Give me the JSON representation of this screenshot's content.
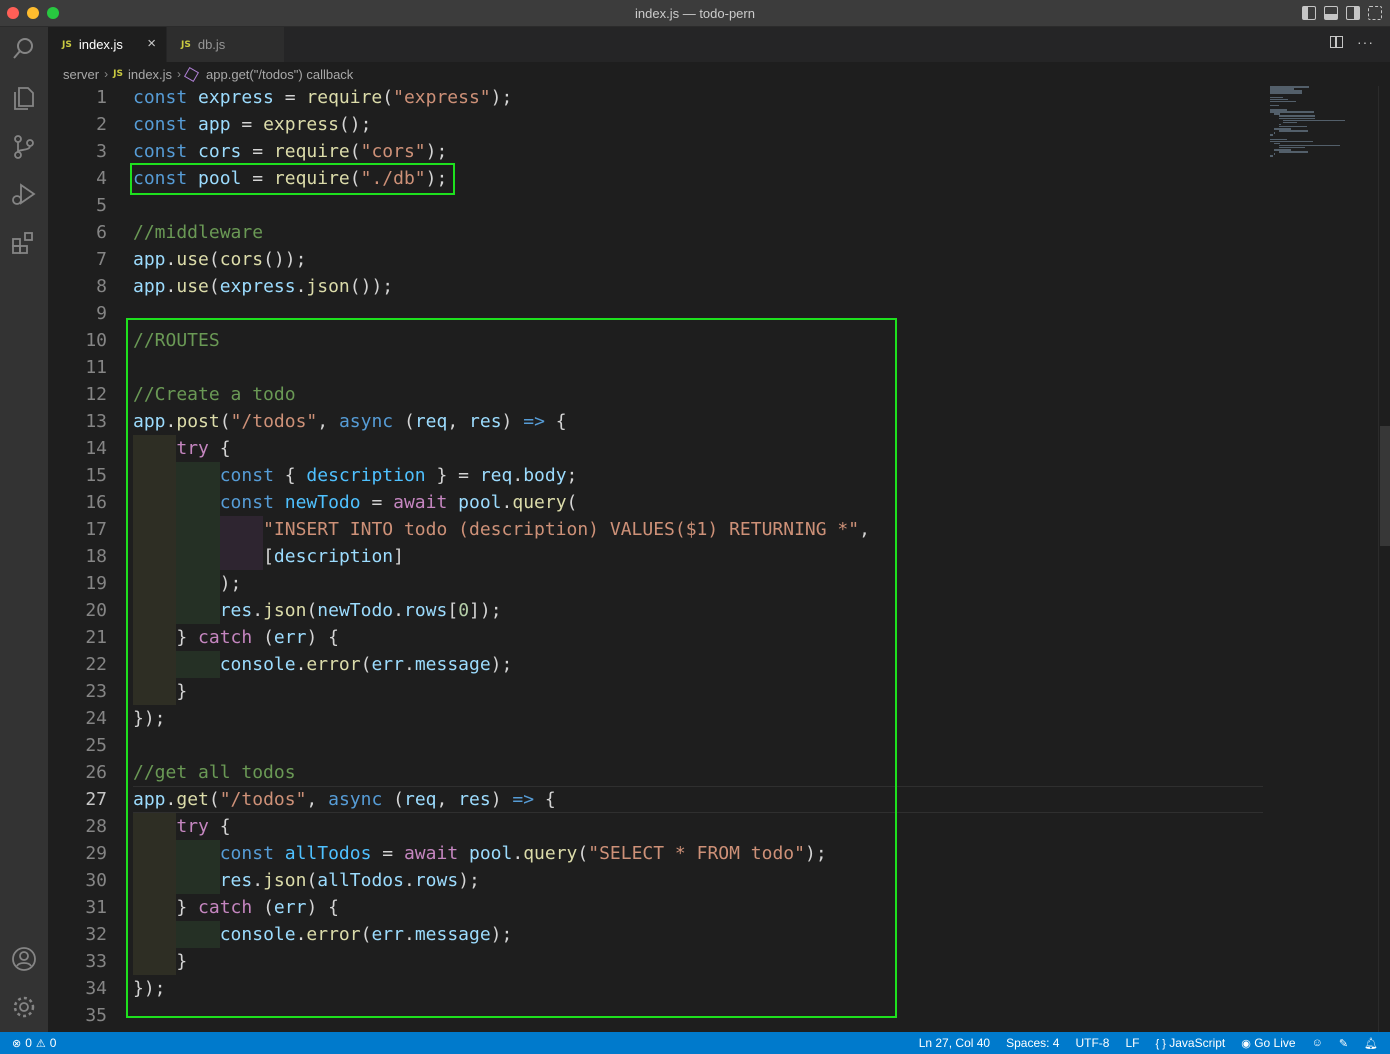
{
  "window": {
    "title": "index.js — todo-pern"
  },
  "tabs": [
    {
      "label": "index.js",
      "badge": "JS",
      "active": true
    },
    {
      "label": "db.js",
      "badge": "JS",
      "active": false
    }
  ],
  "breadcrumb": {
    "folder": "server",
    "file_badge": "JS",
    "file": "index.js",
    "symbol": "app.get(\"/todos\") callback"
  },
  "editor": {
    "active_line": 27,
    "lines": [
      {
        "n": "1"
      },
      {
        "n": "2"
      },
      {
        "n": "3"
      },
      {
        "n": "4"
      },
      {
        "n": "5"
      },
      {
        "n": "6"
      },
      {
        "n": "7"
      },
      {
        "n": "8"
      },
      {
        "n": "9"
      },
      {
        "n": "10"
      },
      {
        "n": "11"
      },
      {
        "n": "12"
      },
      {
        "n": "13"
      },
      {
        "n": "14"
      },
      {
        "n": "15"
      },
      {
        "n": "16"
      },
      {
        "n": "17"
      },
      {
        "n": "18"
      },
      {
        "n": "19"
      },
      {
        "n": "20"
      },
      {
        "n": "21"
      },
      {
        "n": "22"
      },
      {
        "n": "23"
      },
      {
        "n": "24"
      },
      {
        "n": "25"
      },
      {
        "n": "26"
      },
      {
        "n": "27"
      },
      {
        "n": "28"
      },
      {
        "n": "29"
      },
      {
        "n": "30"
      },
      {
        "n": "31"
      },
      {
        "n": "32"
      },
      {
        "n": "33"
      },
      {
        "n": "34"
      },
      {
        "n": "35"
      }
    ],
    "code": {
      "l1": [
        "const",
        " ",
        "express",
        " = ",
        "require",
        "(",
        "\"express\"",
        ");"
      ],
      "l2": [
        "const",
        " ",
        "app",
        " = ",
        "express",
        "();"
      ],
      "l3": [
        "const",
        " ",
        "cors",
        " = ",
        "require",
        "(",
        "\"cors\"",
        ");"
      ],
      "l4": [
        "const",
        " ",
        "pool",
        " = ",
        "require",
        "(",
        "\"./db\"",
        ");"
      ],
      "l6": "//middleware",
      "l7": [
        "app",
        ".",
        "use",
        "(",
        "cors",
        "());"
      ],
      "l8": [
        "app",
        ".",
        "use",
        "(",
        "express",
        ".",
        "json",
        "());"
      ],
      "l10": "//ROUTES",
      "l12": "//Create a todo",
      "l13": [
        "app",
        ".",
        "post",
        "(",
        "\"/todos\"",
        ", ",
        "async",
        " (",
        "req",
        ", ",
        "res",
        ") ",
        "=>",
        " {"
      ],
      "l14": [
        "try",
        " {"
      ],
      "l15": [
        "const",
        " { ",
        "description",
        " } = ",
        "req",
        ".",
        "body",
        ";"
      ],
      "l16": [
        "const",
        " ",
        "newTodo",
        " = ",
        "await",
        " ",
        "pool",
        ".",
        "query",
        "("
      ],
      "l17": [
        "\"INSERT INTO todo (description) VALUES($1) RETURNING *\"",
        ","
      ],
      "l18": [
        "[",
        "description",
        "]"
      ],
      "l19": [
        ");"
      ],
      "l20": [
        "res",
        ".",
        "json",
        "(",
        "newTodo",
        ".",
        "rows",
        "[",
        "0",
        "]);"
      ],
      "l21": [
        "} ",
        "catch",
        " (",
        "err",
        ") {"
      ],
      "l22": [
        "console",
        ".",
        "error",
        "(",
        "err",
        ".",
        "message",
        ");"
      ],
      "l23": [
        "}"
      ],
      "l24": [
        "});"
      ],
      "l26": "//get all todos",
      "l27": [
        "app",
        ".",
        "get",
        "(",
        "\"/todos\"",
        ", ",
        "async",
        " (",
        "req",
        ", ",
        "res",
        ") ",
        "=>",
        " {"
      ],
      "l28": [
        "try",
        " {"
      ],
      "l29": [
        "const",
        " ",
        "allTodos",
        " = ",
        "await",
        " ",
        "pool",
        ".",
        "query",
        "(",
        "\"SELECT * FROM todo\"",
        ");"
      ],
      "l30": [
        "res",
        ".",
        "json",
        "(",
        "allTodos",
        ".",
        "rows",
        ");"
      ],
      "l31": [
        "} ",
        "catch",
        " (",
        "err",
        ") {"
      ],
      "l32": [
        "console",
        ".",
        "error",
        "(",
        "err",
        ".",
        "message",
        ");"
      ],
      "l33": [
        "}"
      ],
      "l34": [
        "});"
      ]
    }
  },
  "statusbar": {
    "errors": "0",
    "warnings": "0",
    "position": "Ln 27, Col 40",
    "spaces": "Spaces: 4",
    "encoding": "UTF-8",
    "eol": "LF",
    "language": "JavaScript",
    "golive": "Go Live"
  },
  "colors": {
    "accent": "#007acc",
    "highlight_box": "#1ee01e"
  }
}
